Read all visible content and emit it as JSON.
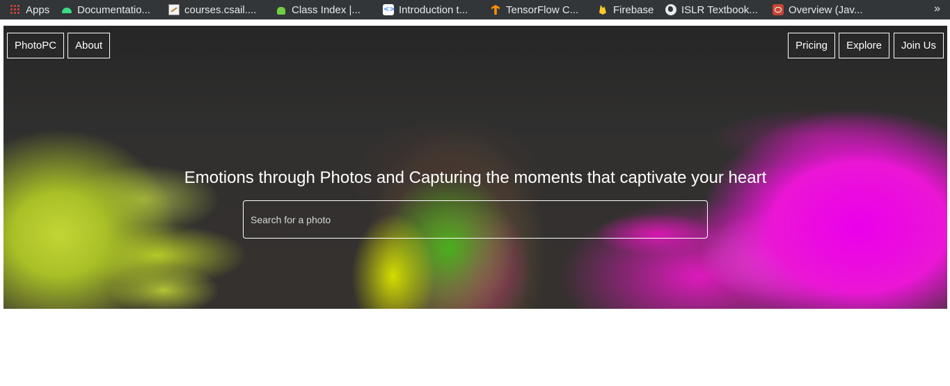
{
  "bookmarks": [
    {
      "label": "Apps",
      "icon": "apps-grid-icon"
    },
    {
      "label": "Documentatio...",
      "icon": "android-icon"
    },
    {
      "label": "courses.csail....",
      "icon": "document-icon"
    },
    {
      "label": "Class Index |...",
      "icon": "android-robot-icon"
    },
    {
      "label": "Introduction t...",
      "icon": "code-brackets-icon"
    },
    {
      "label": "TensorFlow C...",
      "icon": "tensorflow-icon"
    },
    {
      "label": "Firebase",
      "icon": "firebase-icon"
    },
    {
      "label": "ISLR Textbook...",
      "icon": "globe-icon"
    },
    {
      "label": "Overview (Jav...",
      "icon": "oracle-icon"
    }
  ],
  "bookmarks_overflow": "»",
  "nav": {
    "brand": "PhotoPC",
    "about": "About",
    "pricing": "Pricing",
    "explore": "Explore",
    "join": "Join Us"
  },
  "hero": {
    "headline": "Emotions through Photos and Capturing the moments that captivate your heart",
    "search_placeholder": "Search for a photo",
    "search_value": ""
  }
}
